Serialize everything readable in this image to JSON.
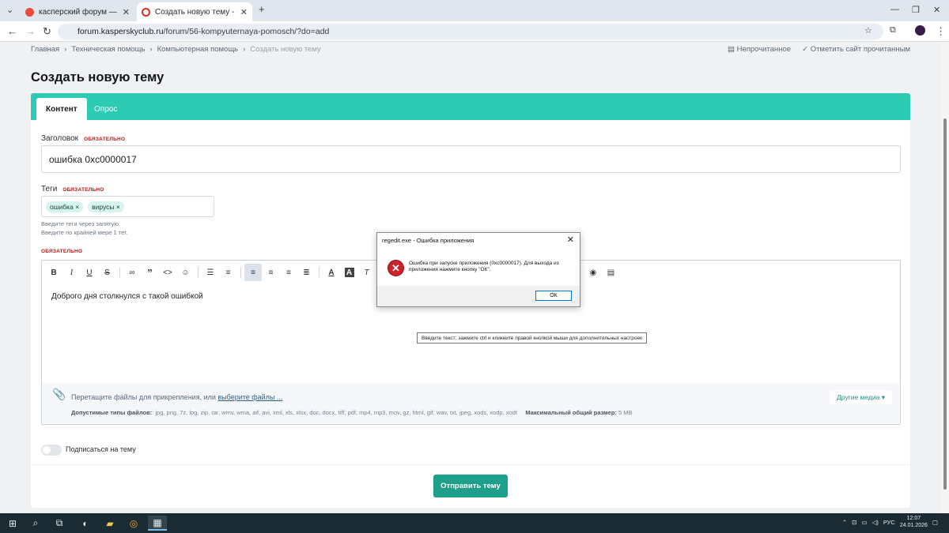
{
  "browser": {
    "tabs": [
      {
        "label": "касперский форум — Яндекс",
        "active": false
      },
      {
        "label": "Создать новую тему - Kaspersky",
        "active": true
      }
    ],
    "url_domain": "forum.kasperskyclub.ru",
    "url_path": "/forum/56-kompyuternaya-pomosch/?do=add"
  },
  "breadcrumb": [
    "Главная",
    "Техническая помощь",
    "Компьютерная помощь",
    "Создать новую тему"
  ],
  "actions": {
    "unread": "Непрочитанное",
    "mark_read": "Отметить сайт прочитанным"
  },
  "page_title": "Создать новую тему",
  "form_tabs": {
    "content": "Контент",
    "poll": "Опрос"
  },
  "title_field": {
    "label": "Заголовок",
    "required": "ОБЯЗАТЕЛЬНО",
    "value": "ошибка 0xc0000017"
  },
  "tags_field": {
    "label": "Теги",
    "required": "ОБЯЗАТЕЛЬНО",
    "tags": [
      "ошибка ×",
      "вирусы ×"
    ],
    "hint1": "Введите теги через запятую.",
    "hint2": "Введите по крайней мере 1 тег."
  },
  "body_required": "ОБЯЗАТЕЛЬНО",
  "editor": {
    "text": "Доброго дня столкнулся с такой ошибкой",
    "tooltip": "Введите текст; зажмите ctrl и кликните правой кнопкой мыши для дополнительных настроек"
  },
  "attachments": {
    "drop_text": "Перетащите файлы для прикрепления, или",
    "choose_link": "выберите файлы ...",
    "types_label": "Допустимые типы файлов:",
    "types": ": jpg, png, 7z, log, zip, rar, wmv, wma, aif, avi, xml, xls, xlsx, doc, docx, tiff, pdf, mp4, mp3, mov, gz, html, gif, wav, txt, jpeg, xods, xodp, xodt",
    "max_label": "Максимальный общий размер:",
    "max_value": "5 MB",
    "other_media": "Другие медиа ▾"
  },
  "subscribe": "Подписаться на тему",
  "submit": "Отправить тему",
  "dialog": {
    "title": "regedit.exe - Ошибка приложения",
    "message": "Ошибка при запуске приложения (0xc0000017). Для выхода из приложения нажмите кнопку \"ОК\".",
    "ok": "ОК"
  },
  "taskbar": {
    "lang": "РУС",
    "time": "12:07",
    "date": "24.01.2026"
  },
  "colors": {
    "accent": "#2dcbb4",
    "submit": "#1e9f89",
    "required": "#b31717"
  }
}
